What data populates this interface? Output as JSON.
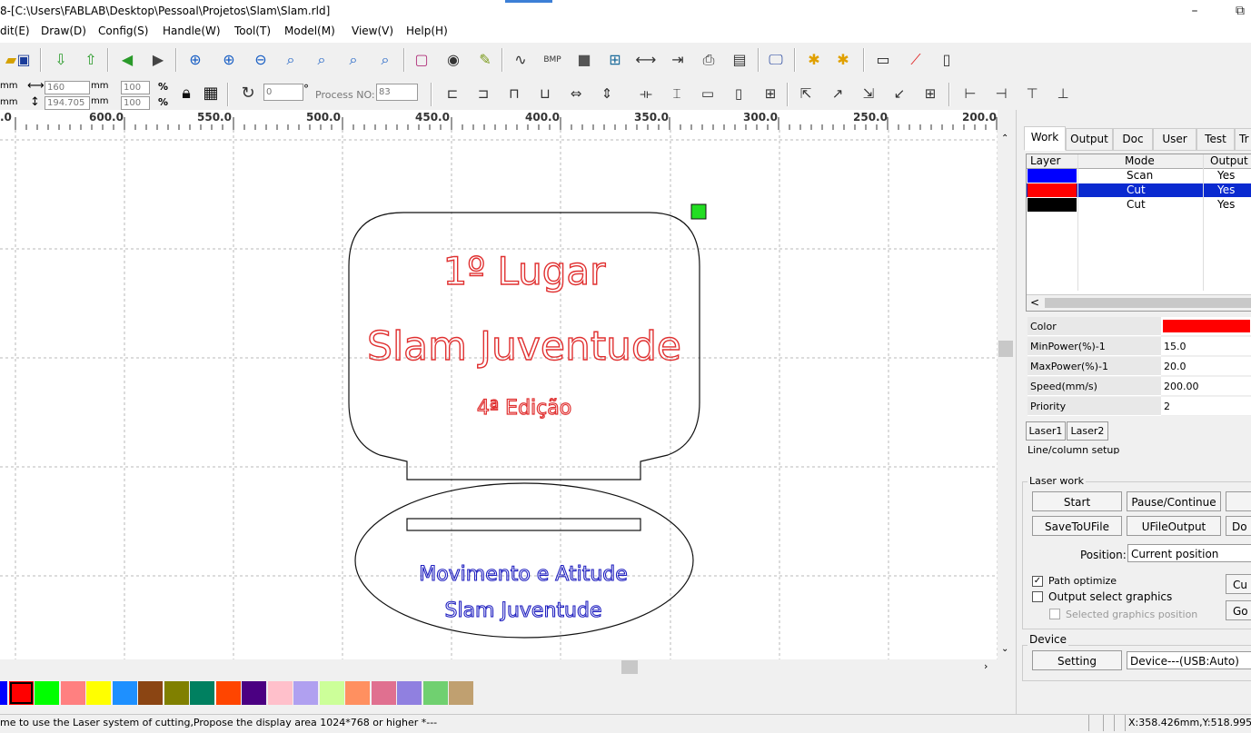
{
  "window": {
    "title": "8-[C:\\Users\\FABLAB\\Desktop\\Pessoal\\Projetos\\Slam\\Slam.rld]",
    "minimize": "–",
    "restore": "⧉"
  },
  "menu": [
    "dit(E)",
    "Draw(D)",
    "Config(S)",
    "Handle(W)",
    "Tool(T)",
    "Model(M)",
    "View(V)",
    "Help(H)"
  ],
  "size_bar": {
    "width_value": "160",
    "height_value": "194.705",
    "unit": "mm",
    "scale_x": "100",
    "scale_y": "100",
    "percent": "%",
    "rotate_value": "0",
    "degree": "°",
    "process_label": "Process NO:",
    "process_value": "83"
  },
  "ruler": {
    "labels": [
      ".0",
      "600.0",
      "550.0",
      "500.0",
      "450.0",
      "400.0",
      "350.0",
      "300.0",
      "250.0",
      "200.0"
    ]
  },
  "design": {
    "title_text": "1º Lugar",
    "main_text": "Slam Juventude",
    "edition_text": "4ª Edição",
    "base_line1": "Movimento e Atitude",
    "base_line2": "Slam Juventude",
    "red_color": "#e03030",
    "blue_color": "#2020c0",
    "marker_color": "#22dd22"
  },
  "palette": [
    "#0000ff",
    "#ff0000",
    "#00ff00",
    "#ff8080",
    "#ffff00",
    "#1e90ff",
    "#8b4513",
    "#808000",
    "#008060",
    "#ff4500",
    "#4b0082",
    "#ffc0cb",
    "#b0a0f0",
    "#ccff99",
    "#ff9060",
    "#e07090",
    "#9080e0",
    "#70d070",
    "#c0a070"
  ],
  "status": {
    "message": "me to use the Laser system of cutting,Propose the display area 1024*768 or higher *---",
    "coords": "X:358.426mm,Y:518.995mm"
  },
  "panel": {
    "tabs": [
      "Work",
      "Output",
      "Doc",
      "User",
      "Test",
      "Tr"
    ],
    "layer_headers": [
      "Layer",
      "Mode",
      "Output"
    ],
    "layers": [
      {
        "color": "#0000ff",
        "mode": "Scan",
        "output": "Yes",
        "selected": false
      },
      {
        "color": "#ff0000",
        "mode": "Cut",
        "output": "Yes",
        "selected": true
      },
      {
        "color": "#000000",
        "mode": "Cut",
        "output": "Yes",
        "selected": false
      }
    ],
    "scroll_left": "<",
    "props": [
      {
        "name": "Color",
        "value": ""
      },
      {
        "name": "MinPower(%)-1",
        "value": "15.0"
      },
      {
        "name": "MaxPower(%)-1",
        "value": "20.0"
      },
      {
        "name": "Speed(mm/s)",
        "value": "200.00"
      },
      {
        "name": "Priority",
        "value": "2"
      }
    ],
    "laser_tabs": [
      "Laser1",
      "Laser2"
    ],
    "line_setup": "Line/column setup",
    "laser_work_title": "Laser work",
    "buttons": {
      "start": "Start",
      "pause": "Pause/Continue",
      "save_u": "SaveToUFile",
      "ufile_output": "UFileOutput",
      "download": "Do",
      "cut": "Cu",
      "go": "Go"
    },
    "position_label": "Position:",
    "position_value": "Current position",
    "path_optimize": "Path optimize",
    "output_select": "Output select graphics",
    "selected_pos": "Selected graphics position",
    "device_title": "Device",
    "setting": "Setting",
    "device_value": "Device---(USB:Auto)"
  }
}
